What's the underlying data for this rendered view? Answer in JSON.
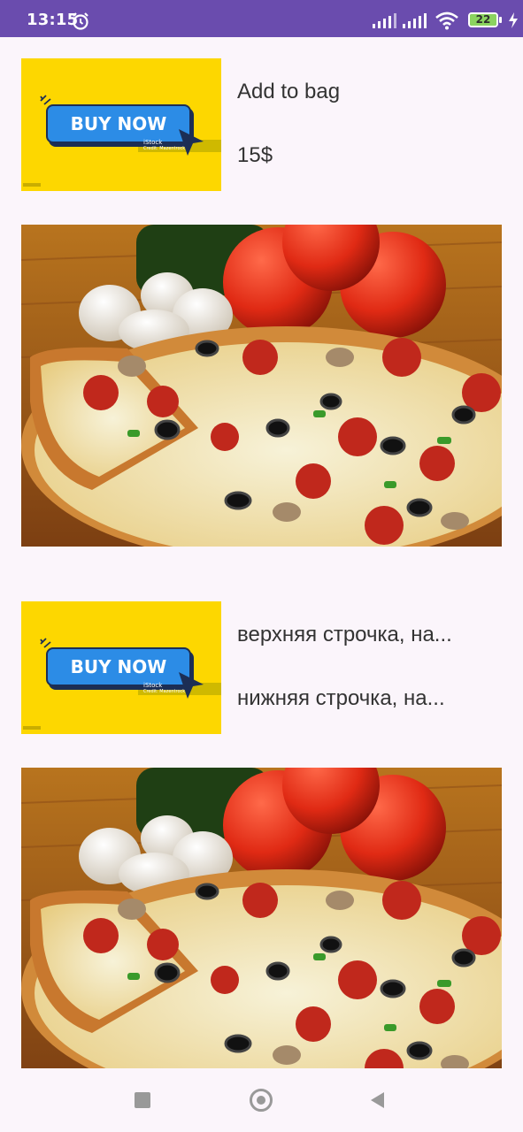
{
  "status_bar": {
    "time": "13:15",
    "battery_level": "22",
    "icons": [
      "alarm-icon",
      "signal-icon",
      "signal-icon",
      "wifi-icon",
      "battery-icon",
      "charging-bolt-icon"
    ]
  },
  "items": [
    {
      "image": {
        "button_text": "BUY NOW",
        "watermark": "iStock",
        "watermark_credit": "Credit: Mazentrock"
      },
      "top_text": "Add to bag",
      "bottom_text": "15$"
    },
    {
      "image": {
        "button_text": "BUY NOW",
        "watermark": "iStock",
        "watermark_credit": "Credit: Mazentrock"
      },
      "top_text": "верхняя строчка, на...",
      "bottom_text": "нижняя строчка, на..."
    }
  ],
  "nav_bar": {
    "icons": [
      "recents-square-icon",
      "home-circle-icon",
      "back-triangle-icon"
    ]
  },
  "colors": {
    "status_bar": "#6a4cae",
    "background": "#fbf5fb",
    "buy_banner": "#fdd700",
    "buy_button": "#2c8ce6"
  }
}
